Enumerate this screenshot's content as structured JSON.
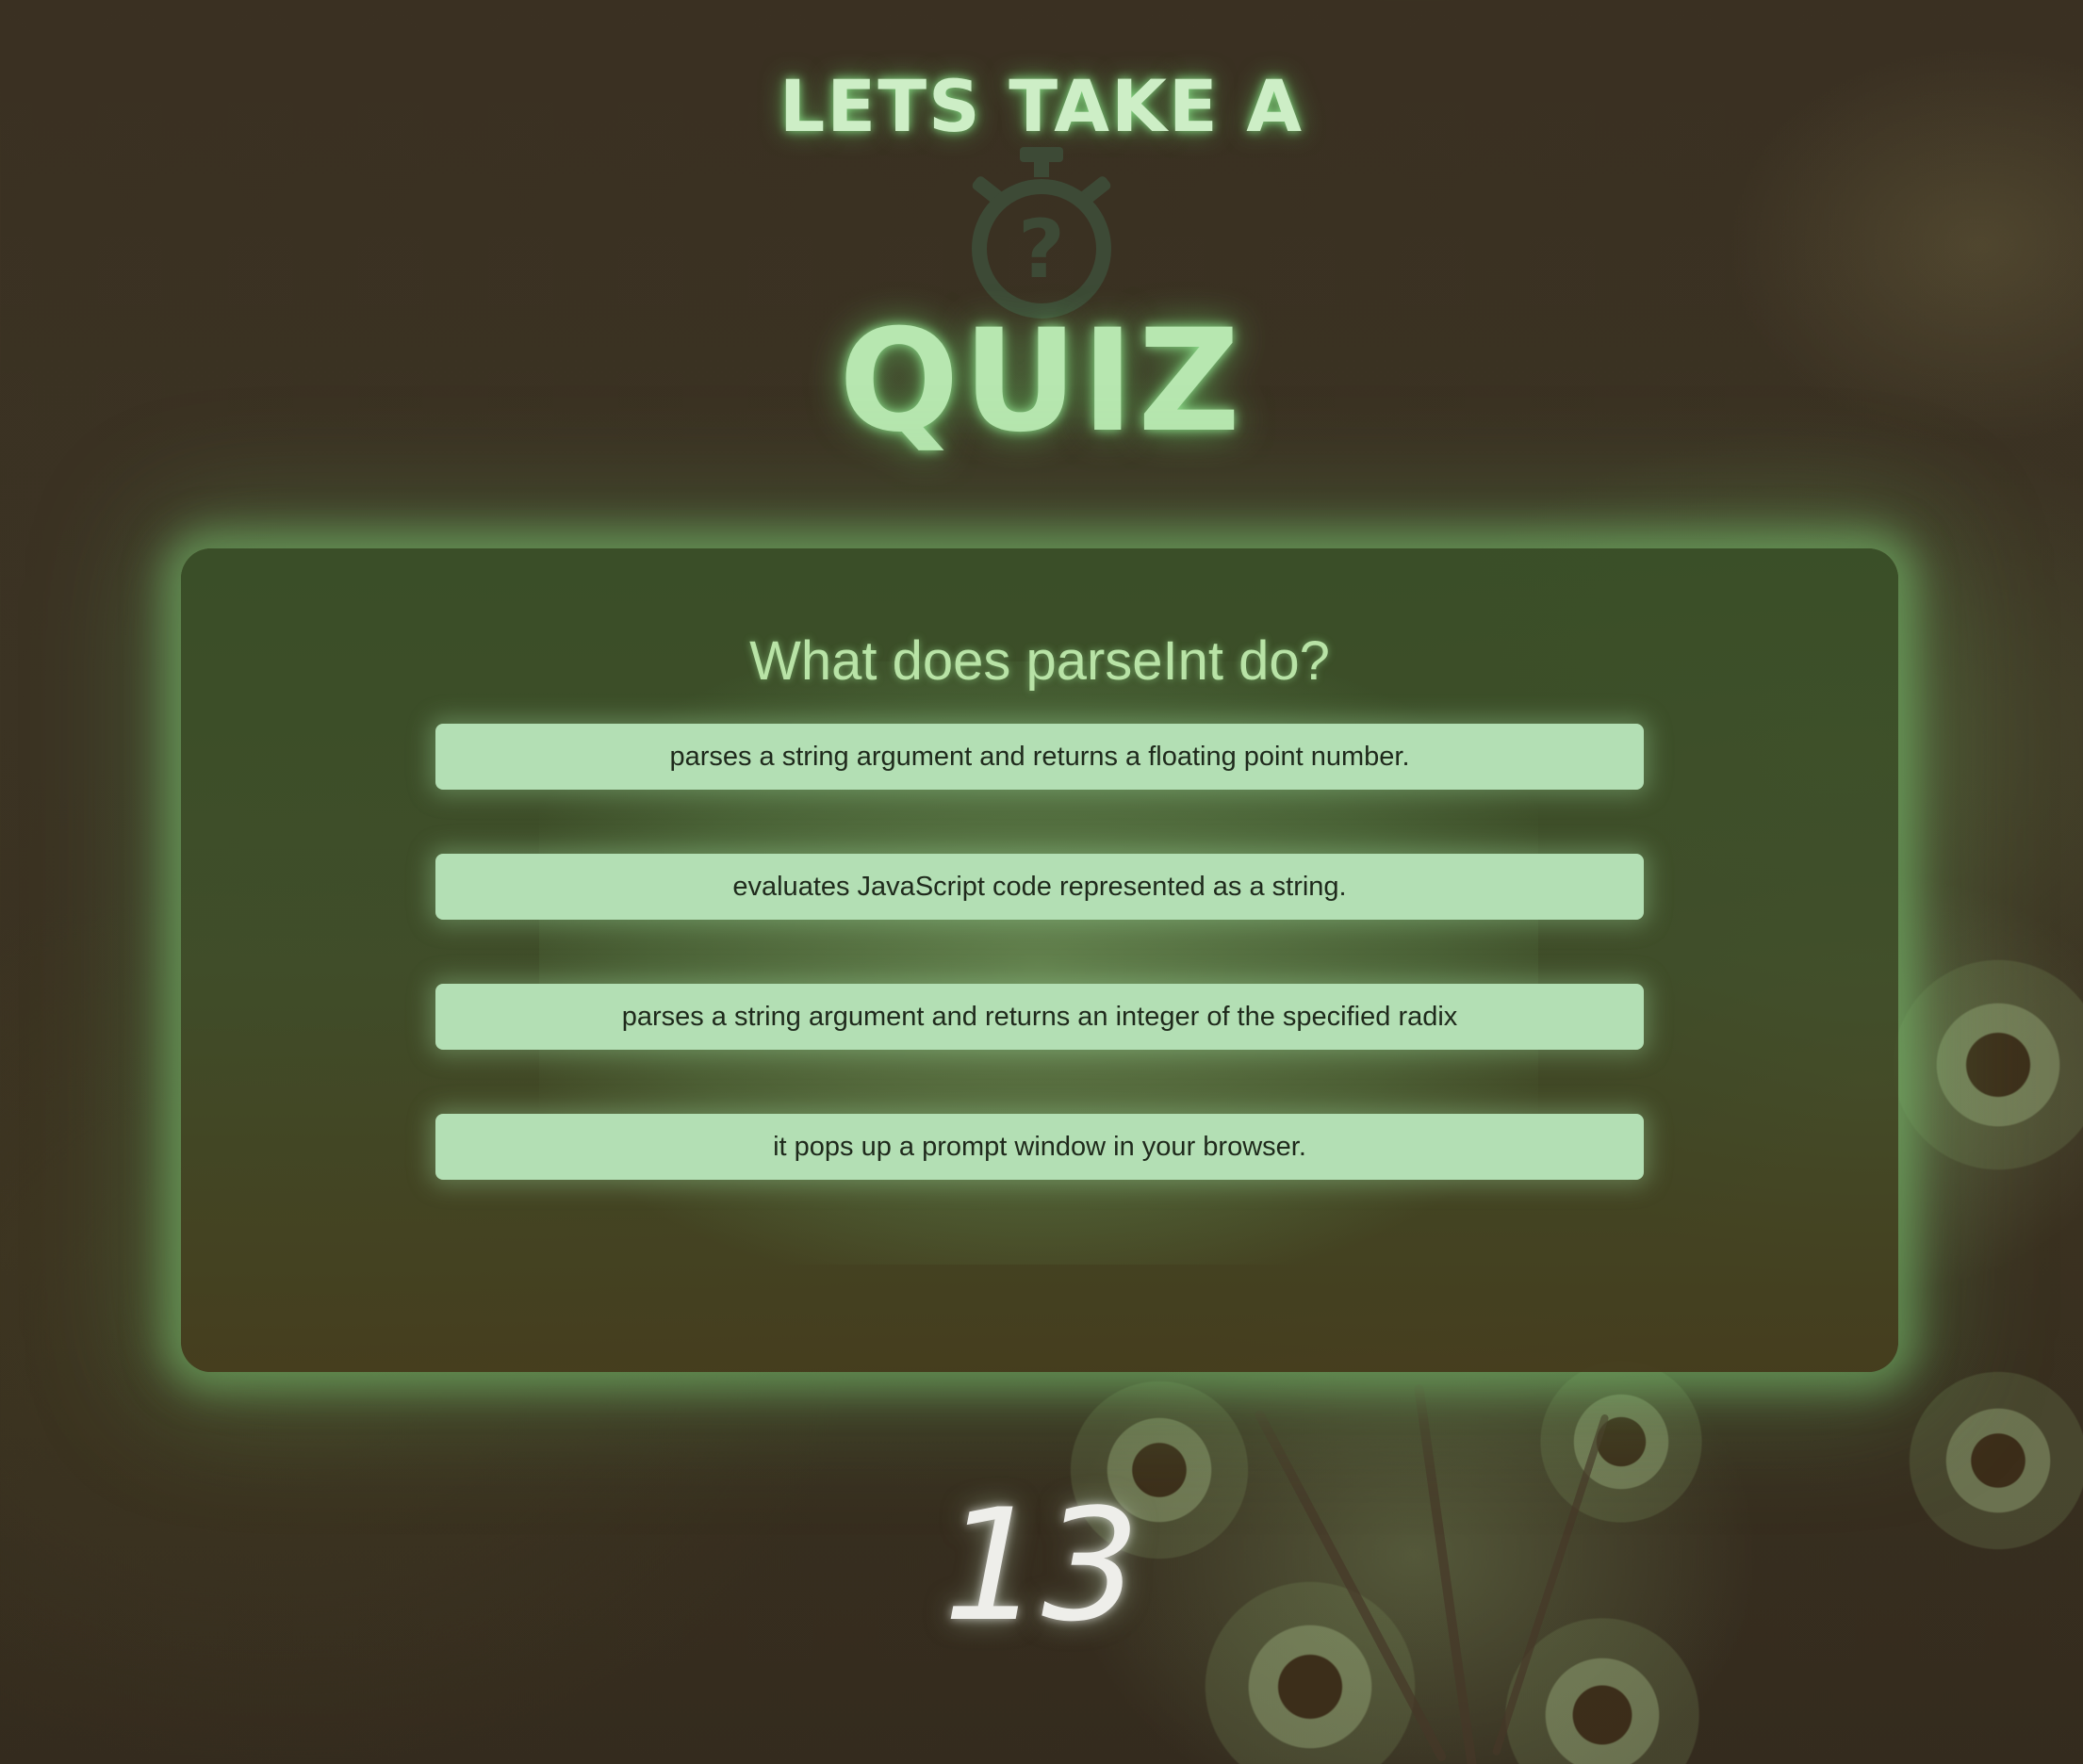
{
  "header": {
    "title_top": "LETS TAKE A",
    "title_main": "QUIZ",
    "stopwatch_icon": "stopwatch-question-icon"
  },
  "quiz": {
    "question": "What does parseInt do?",
    "answers": [
      "parses a string argument and returns a floating point number.",
      "evaluates JavaScript code represented as a string.",
      "parses a string argument and returns an integer of the specified radix",
      "it pops up a prompt window in your browser."
    ]
  },
  "timer": {
    "seconds_left": "13"
  },
  "colors": {
    "accent_glow": "#9be69a",
    "answer_bg": "#b3dfb4",
    "question_text": "#b8e3a6",
    "background": "#3a3022"
  }
}
